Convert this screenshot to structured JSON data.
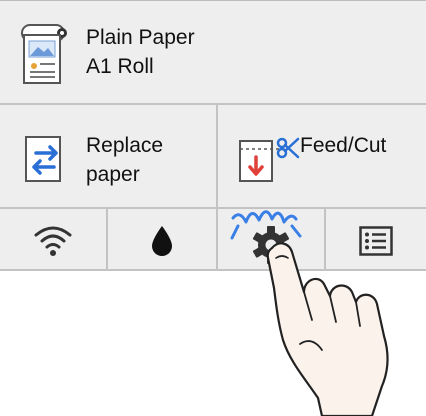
{
  "media": {
    "line1": "Plain Paper",
    "line2": "A1 Roll",
    "icon": "roll-paper-icon"
  },
  "actions": {
    "replace_line1": "Replace",
    "replace_line2": "paper",
    "replace_icon": "replace-paper-icon",
    "feed_cut_label": "Feed/Cut",
    "feed_cut_icon": "feed-cut-icon"
  },
  "bottom_icons": [
    "wifi-icon",
    "ink-drop-icon",
    "gear-icon",
    "list-icon"
  ],
  "overlay": {
    "hand_icon": "tapping-hand-icon",
    "tap_indicator": "tap-highlight-icon"
  },
  "colors": {
    "panel_bg": "#eeeeef",
    "divider": "#c3c3c3",
    "accent_blue": "#2a6fd6",
    "feed_red": "#e0403a",
    "tap_blue": "#3a7fe6"
  }
}
